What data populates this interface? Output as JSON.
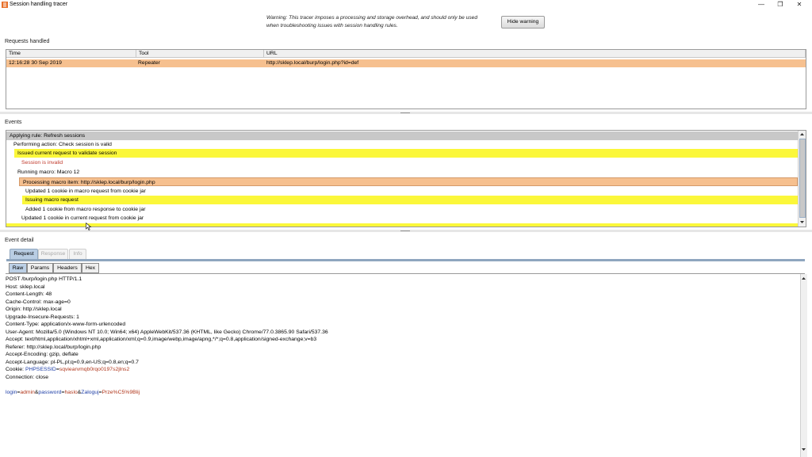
{
  "window": {
    "title": "Session handling tracer",
    "minimize_glyph": "—",
    "maximize_glyph": "❐",
    "close_glyph": "✕"
  },
  "warning": {
    "line1": "Warning: This tracer imposes a processing and storage overhead, and should only be used",
    "line2": "when troubleshooting issues with session handling rules.",
    "button": "Hide warning"
  },
  "requests": {
    "heading": "Requests handled",
    "columns": [
      "Time",
      "Tool",
      "URL"
    ],
    "rows": [
      {
        "time": "12:16:28 30 Sep 2019",
        "tool": "Repeater",
        "url": "http://sklep.local/burp/login.php?id=def"
      }
    ]
  },
  "events": {
    "heading": "Events",
    "items": [
      {
        "text": "Applying rule: Refresh sessions"
      },
      {
        "text": "Performing action: Check session is valid"
      },
      {
        "text": "Issued current request to validate session"
      },
      {
        "text": "Session is invalid"
      },
      {
        "text": "Running macro: Macro 12"
      },
      {
        "text": "Processing macro item: http://sklep.local/burp/login.php"
      },
      {
        "text": "Updated 1 cookie in macro request from cookie jar"
      },
      {
        "text": "Issuing macro request"
      },
      {
        "text": "Added 1 cookie from macro response to cookie jar"
      },
      {
        "text": "Updated 1 cookie in current request from cookie jar"
      }
    ]
  },
  "detail": {
    "heading": "Event detail",
    "tabs": [
      "Request",
      "Response",
      "Info"
    ],
    "subtabs": [
      "Raw",
      "Params",
      "Headers",
      "Hex"
    ],
    "request_lines": [
      "POST /burp/login.php HTTP/1.1",
      "Host: sklep.local",
      "Content-Length: 48",
      "Cache-Control: max-age=0",
      "Origin: http://sklep.local",
      "Upgrade-Insecure-Requests: 1",
      "Content-Type: application/x-www-form-urlencoded",
      "User-Agent: Mozilla/5.0 (Windows NT 10.0; Win64; x64) AppleWebKit/537.36 (KHTML, like Gecko) Chrome/77.0.3865.90 Safari/537.36",
      "Accept: text/html,application/xhtml+xml,application/xml;q=0.9,image/webp,image/apng,*/*;q=0.8,application/signed-exchange;v=b3",
      "Referer: http://sklep.local/burp/login.php",
      "Accept-Encoding: gzip, deflate",
      "Accept-Language: pl-PL,pl;q=0.9,en-US;q=0.8,en;q=0.7"
    ],
    "cookie": {
      "prefix": "Cookie: ",
      "name": "PHPSESSID",
      "eq": "=",
      "value": "sqviearvmqb0rqo0197s2jlns2"
    },
    "connection": "Connection: close",
    "body_params": [
      {
        "name": "login",
        "value": "admin"
      },
      {
        "name": "password",
        "value": "haslo"
      },
      {
        "name": "Zaloguj",
        "value": "Prze%C5%9Blij"
      }
    ],
    "sep_eq": "=",
    "sep_amp": "&"
  },
  "colors": {
    "selected_row": "#f6c08f",
    "highlight_yellow": "#fbf73a",
    "invalid_text": "#c0392b",
    "param_name": "#1d3da6",
    "param_value": "#b0361b",
    "tab_active": "#b9cde3"
  }
}
